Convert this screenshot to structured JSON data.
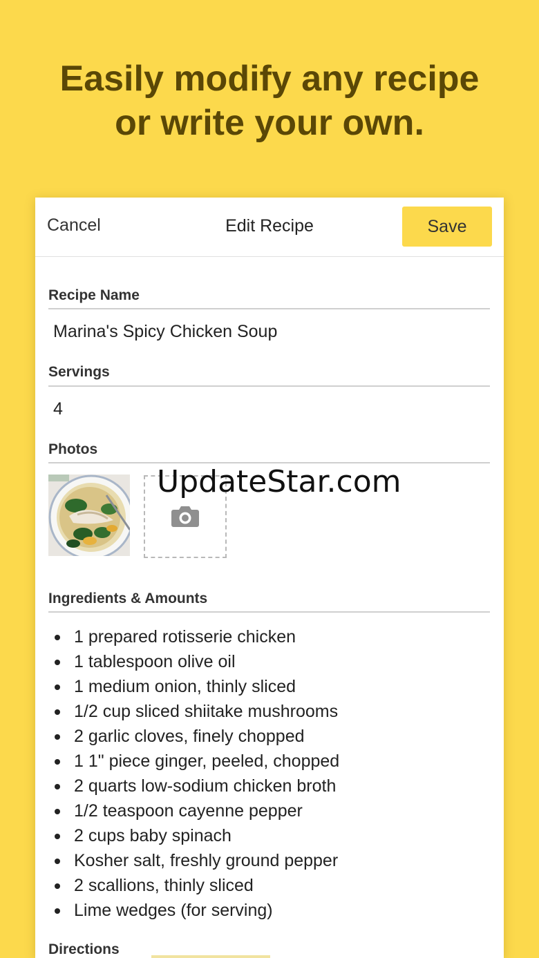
{
  "headline": {
    "line1": "Easily modify any recipe",
    "line2": "or write your own."
  },
  "nav": {
    "cancel_label": "Cancel",
    "title": "Edit Recipe",
    "save_label": "Save"
  },
  "form": {
    "recipe_name_label": "Recipe Name",
    "recipe_name_value": "Marina's Spicy Chicken Soup",
    "servings_label": "Servings",
    "servings_value": "4",
    "photos_label": "Photos",
    "add_photo_icon": "camera-icon",
    "ingredients_label": "Ingredients & Amounts",
    "ingredients": [
      "1 prepared rotisserie chicken",
      "1 tablespoon olive oil",
      "1 medium onion, thinly sliced",
      "1/2 cup sliced shiitake mushrooms",
      "2 garlic cloves, finely chopped",
      "1 1\" piece ginger, peeled, chopped",
      "2 quarts low-sodium chicken broth",
      "1/2 teaspoon cayenne pepper",
      "2 cups baby spinach",
      "Kosher salt, freshly ground pepper",
      "2 scallions, thinly sliced",
      "Lime wedges (for serving)"
    ],
    "directions_label": "Directions"
  },
  "watermark": "UpdateStar.com",
  "colors": {
    "background": "#fcd94c",
    "headline": "#5a4706",
    "save_button": "#fcd94c"
  }
}
